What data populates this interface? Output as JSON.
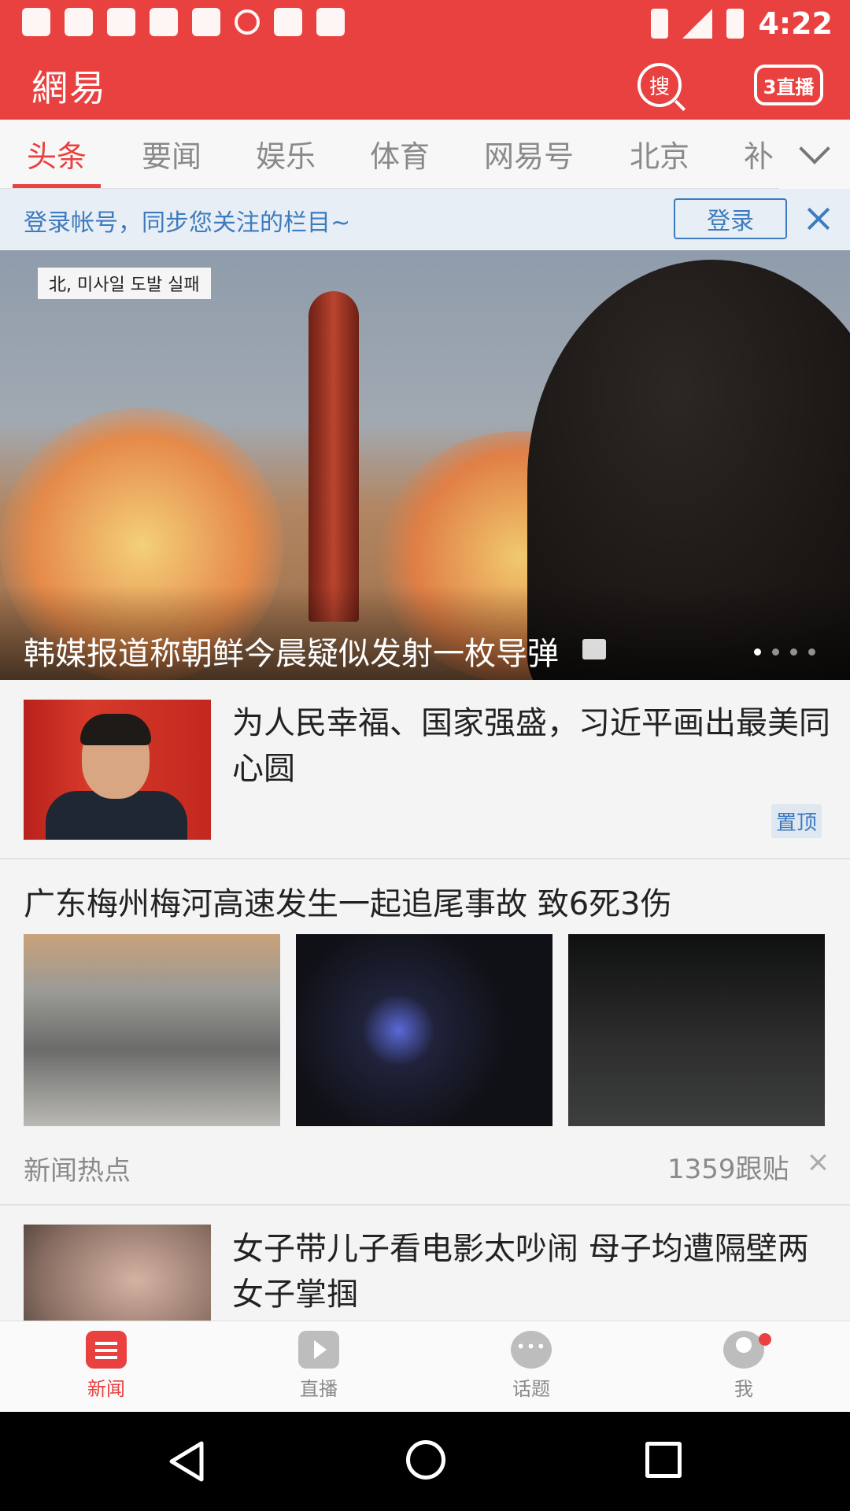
{
  "status_bar": {
    "time": "4:22"
  },
  "header": {
    "logo": "網易",
    "search_label": "搜",
    "live_label": "3直播"
  },
  "tabs": [
    {
      "label": "头条",
      "active": true
    },
    {
      "label": "要闻"
    },
    {
      "label": "娱乐"
    },
    {
      "label": "体育"
    },
    {
      "label": "网易号"
    },
    {
      "label": "北京"
    },
    {
      "label": "补"
    }
  ],
  "login_banner": {
    "text": "登录帐号，同步您关注的栏目~",
    "button": "登录"
  },
  "hero": {
    "overlay_caption": "北, 미사일 도발 실패",
    "title": "韩媒报道称朝鲜今晨疑似发射一枚导弹",
    "dot_count": 4,
    "active_dot": 0
  },
  "articles": [
    {
      "title": "为人民幸福、国家强盛，习近平画出最美同心圆",
      "badge": "置顶"
    },
    {
      "title": "广东梅州梅河高速发生一起追尾事故 致6死3伤",
      "source": "新闻热点",
      "comments": "1359跟贴"
    },
    {
      "title": "女子带儿子看电影太吵闹 母子均遭隔壁两女子掌掴"
    }
  ],
  "bottom_nav": [
    {
      "label": "新闻",
      "icon": "news-icon",
      "active": true
    },
    {
      "label": "直播",
      "icon": "play-icon"
    },
    {
      "label": "话题",
      "icon": "chat-icon"
    },
    {
      "label": "我",
      "icon": "profile-icon"
    }
  ],
  "colors": {
    "brand": "#e8413f",
    "link": "#3d7bbf"
  }
}
